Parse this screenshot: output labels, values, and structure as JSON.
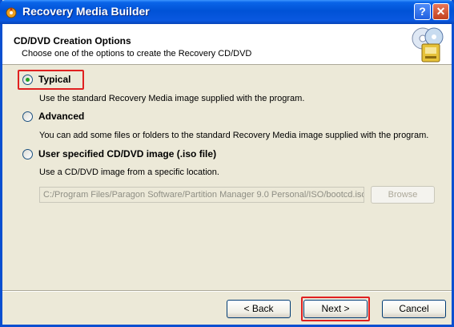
{
  "window": {
    "title": "Recovery Media Builder",
    "help_label": "?",
    "close_label": "✕"
  },
  "header": {
    "title": "CD/DVD Creation Options",
    "subtitle": "Choose one of the options to create the Recovery CD/DVD"
  },
  "options": {
    "typical": {
      "label": "Typical",
      "selected": true,
      "description": "Use the standard Recovery Media image supplied with the program."
    },
    "advanced": {
      "label": "Advanced",
      "selected": false,
      "description": "You can add some files or folders to the standard Recovery Media image supplied with the program."
    },
    "custom": {
      "label": "User specified CD/DVD image (.iso file)",
      "selected": false,
      "description": "Use a CD/DVD image from a specific location.",
      "path_value": "C:/Program Files/Paragon Software/Partition Manager 9.0 Personal/ISO/bootcd.iso",
      "browse_label": "Browse"
    }
  },
  "footer": {
    "back_label": "< Back",
    "next_label": "Next >",
    "cancel_label": "Cancel"
  },
  "colors": {
    "highlight": "#e02020",
    "titlebar": "#0052d6",
    "dialog_bg": "#ece9d8"
  }
}
